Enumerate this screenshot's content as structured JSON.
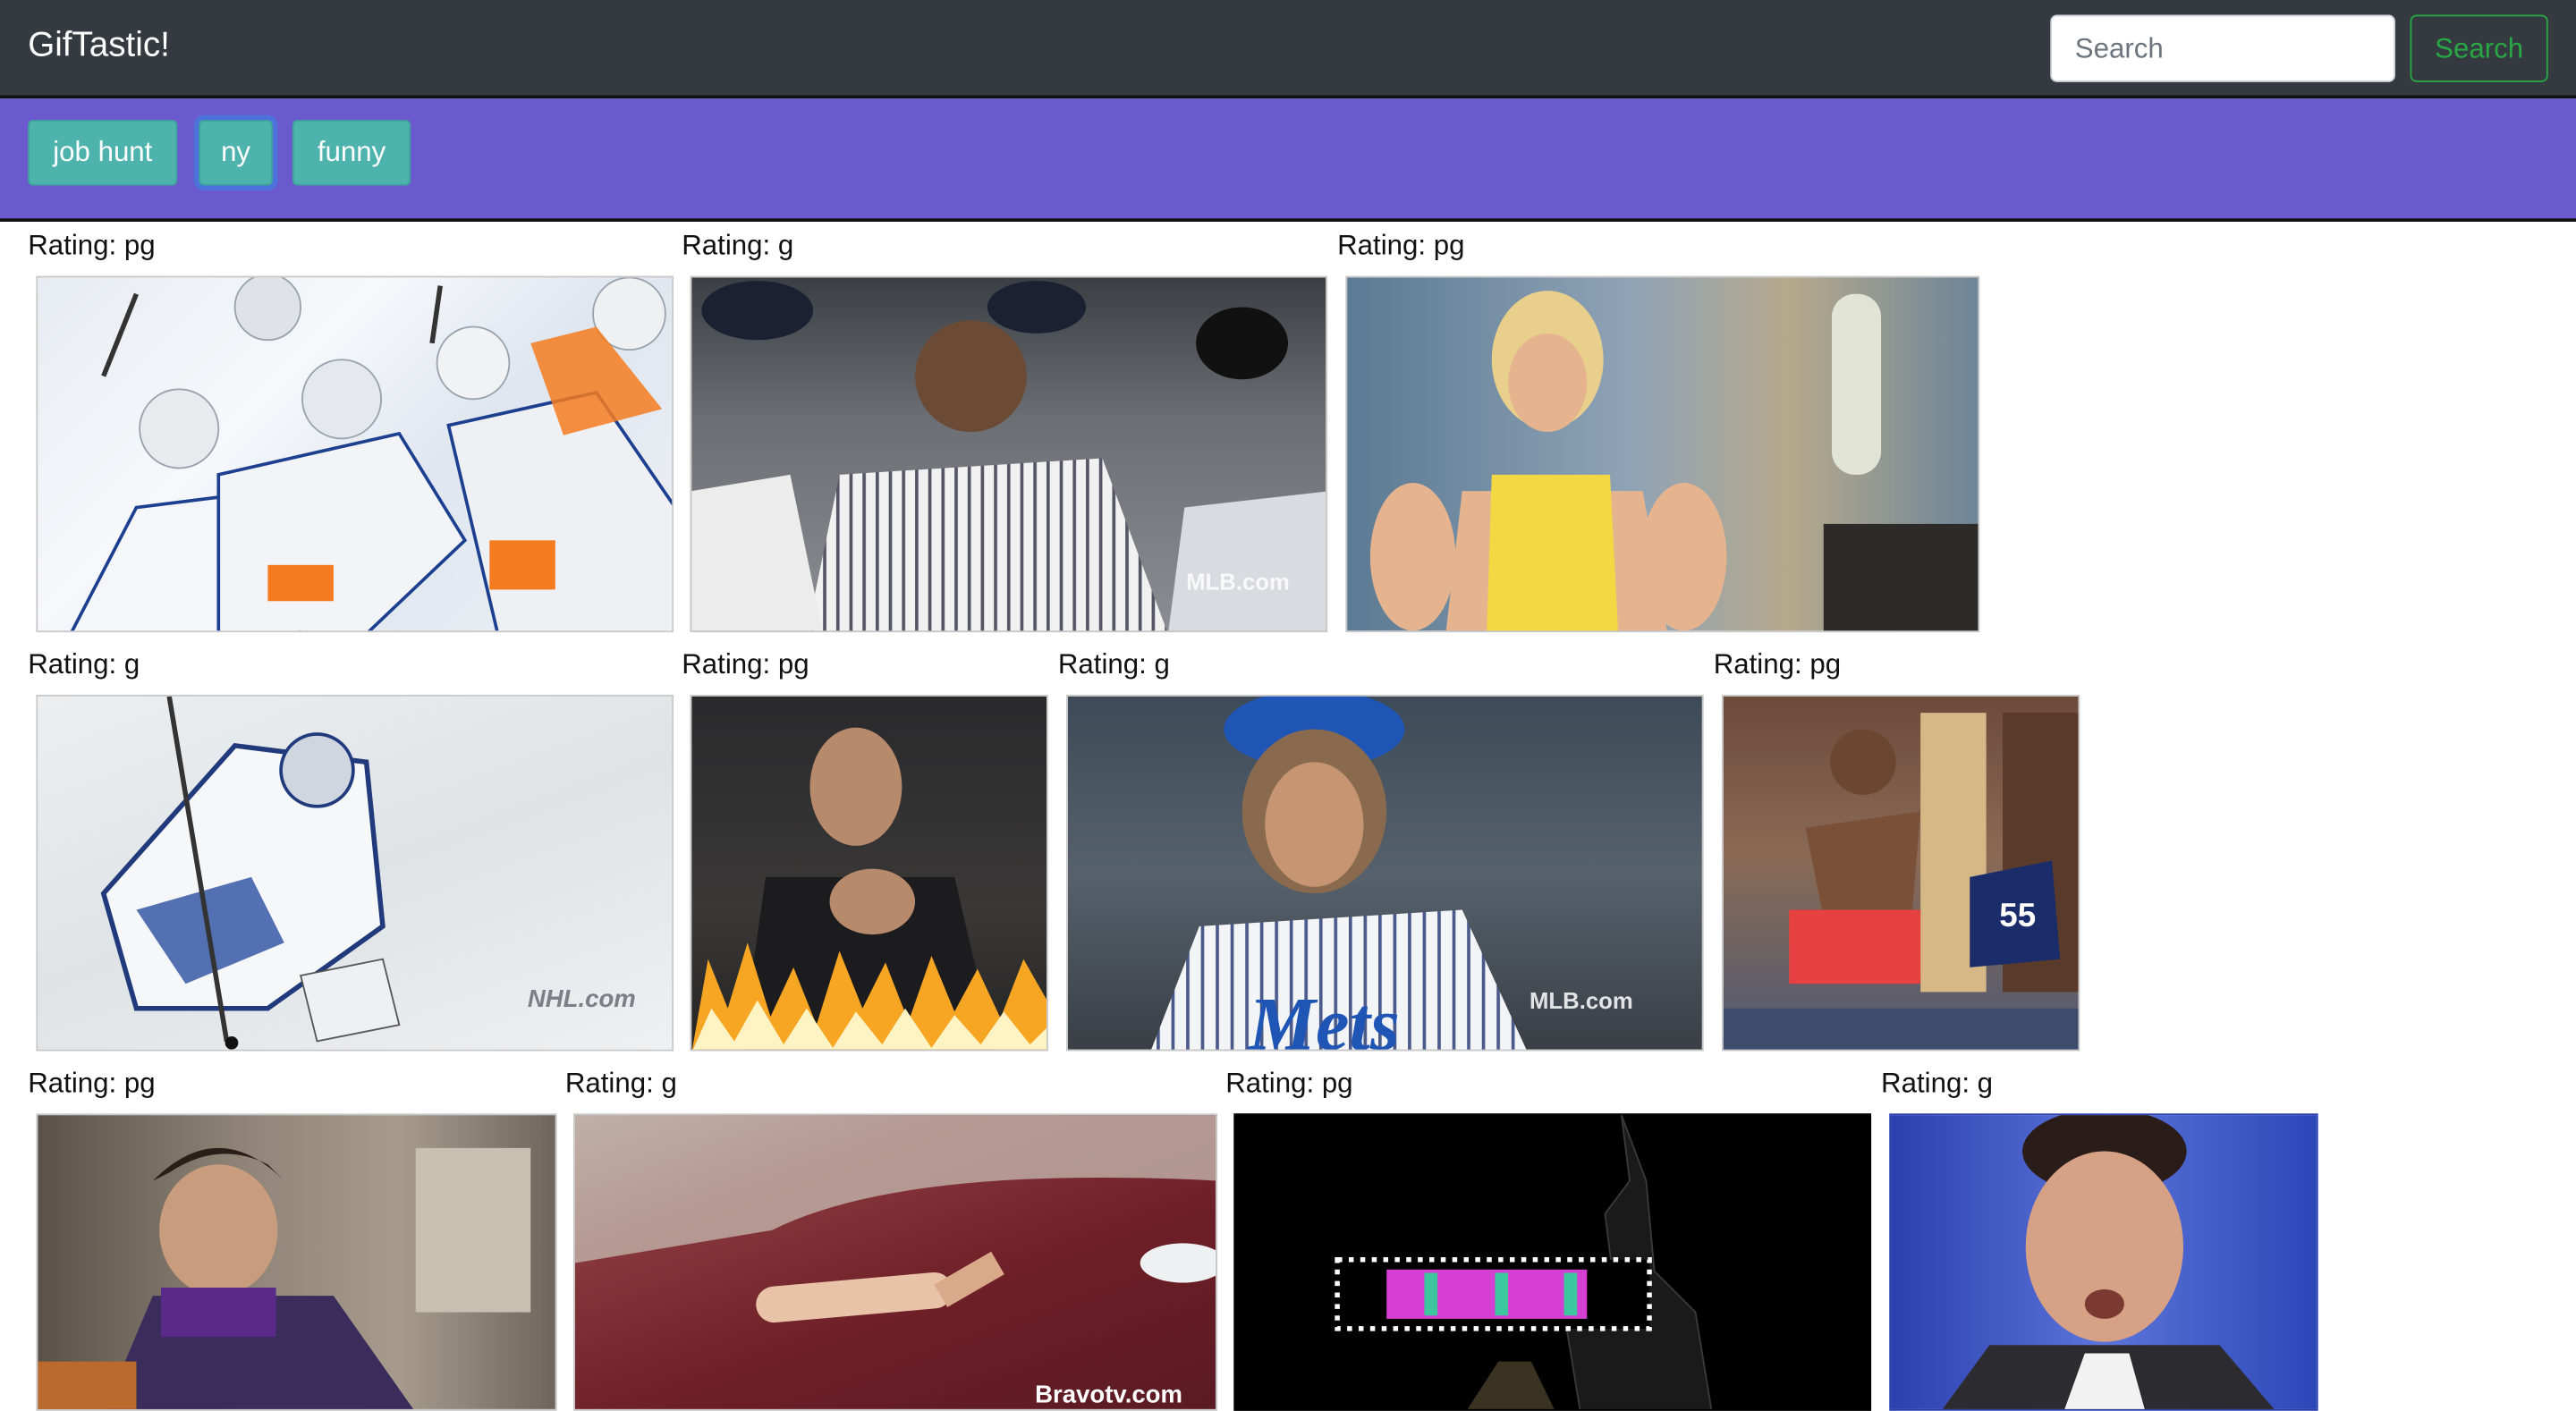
{
  "navbar": {
    "brand": "GifTastic!",
    "search_placeholder": "Search",
    "search_button": "Search"
  },
  "topics": [
    {
      "label": "job hunt"
    },
    {
      "label": "ny"
    },
    {
      "label": "funny"
    }
  ],
  "gifs": [
    {
      "rating": "Rating: pg",
      "subject": "hockey players celebrating"
    },
    {
      "rating": "Rating: g",
      "subject": "yankees player in dugout"
    },
    {
      "rating": "Rating: pg",
      "subject": "woman in yellow top reacting"
    },
    {
      "rating": "Rating: g",
      "subject": "rangers goalie on ice"
    },
    {
      "rating": "Rating: pg",
      "subject": "man in suit with flames"
    },
    {
      "rating": "Rating: g",
      "subject": "mets pitcher"
    },
    {
      "rating": "Rating: pg",
      "subject": "football player dancing in locker room"
    },
    {
      "rating": "Rating: pg",
      "subject": "man asleep on subway"
    },
    {
      "rating": "Rating: g",
      "subject": "prosthetic leg on red floor"
    },
    {
      "rating": "Rating: pg",
      "subject": "statue of liberty light show"
    },
    {
      "rating": "Rating: g",
      "subject": "man making surprised face"
    }
  ],
  "watermarks": {
    "mlb": "MLB.com",
    "nhl": "NHL.com",
    "bravo": "Bravotv.com"
  },
  "colors": {
    "navbar": "#343a40",
    "topic_bar": "#6a5acd",
    "topic_button": "#4fb3ad",
    "search_button": "#28a745"
  }
}
